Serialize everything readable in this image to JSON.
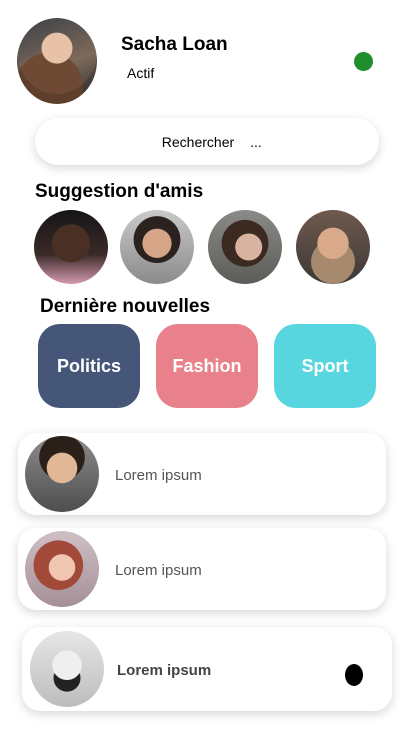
{
  "profile": {
    "name": "Sacha Loan",
    "status": "Actif",
    "status_color": "#1f8e2c"
  },
  "search": {
    "placeholder": "Rechercher",
    "ellipsis": "..."
  },
  "friends": {
    "title": "Suggestion d'amis",
    "count": 4
  },
  "news": {
    "title": "Dernière nouvelles",
    "categories": [
      {
        "label": "Politics",
        "color": "#465679"
      },
      {
        "label": "Fashion",
        "color": "#e8818b"
      },
      {
        "label": "Sport",
        "color": "#57d6e0"
      }
    ]
  },
  "feed": {
    "items": [
      {
        "text": "Lorem ipsum"
      },
      {
        "text": "Lorem ipsum"
      },
      {
        "text": "Lorem ipsum",
        "unread": true
      }
    ]
  }
}
